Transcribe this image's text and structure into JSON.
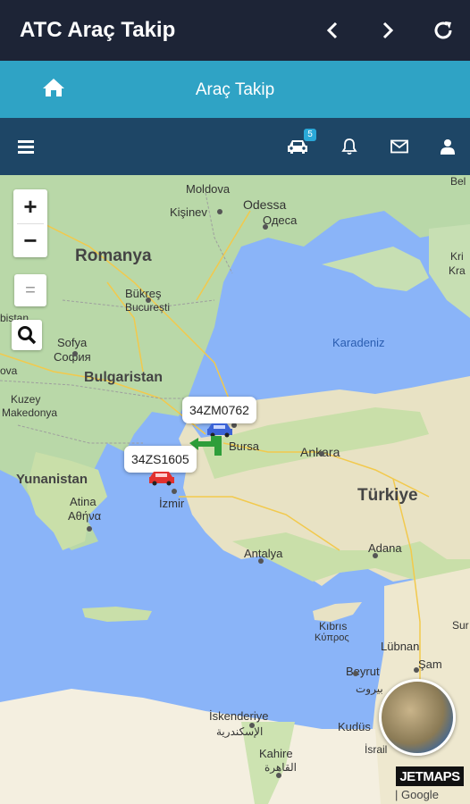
{
  "app": {
    "title": "ATC Araç Takip"
  },
  "subheader": {
    "title": "Araç Takip"
  },
  "navbar": {
    "vehicle_badge": "5"
  },
  "map": {
    "zoom_in": "+",
    "zoom_out": "−",
    "layers_btn": "=",
    "labels": {
      "moldova": "Moldova",
      "kisinev": "Kişinev",
      "odessa": "Odessa",
      "odesa": "Одеса",
      "romanya": "Romanya",
      "bukres": "Bükreş",
      "bukres_local": "București",
      "sofya": "Sofya",
      "sofiya": "София",
      "bulgaristan": "Bulgaristan",
      "kuzey_makedonya_1": "Kuzey",
      "kuzey_makedonya_2": "Makedonya",
      "bistan": "bistan",
      "ova": "ova",
      "yunanistan": "Yunanistan",
      "atina": "Atina",
      "athina": "Αθήνα",
      "karadeniz": "Karadeniz",
      "bursa": "Bursa",
      "ankara": "Ankara",
      "izmir": "İzmir",
      "turkiye": "Türkiye",
      "antalya": "Antalya",
      "adana": "Adana",
      "kibris": "Kıbrıs",
      "kibris_greek": "Κύπρος",
      "lubnan": "Lübnan",
      "beyrut": "Beyrut",
      "beyrut_arabic": "بيروت",
      "sam": "Şam",
      "iskenderiye": "İskenderiye",
      "iskenderiye_arabic": "الإسكندرية",
      "kudus": "Kudüs",
      "kahire": "Kahire",
      "kahire_arabic": "القاهرة",
      "israil": "İsrail",
      "krasnodar": "Kra",
      "crimea": "Kri",
      "bel": "Bel",
      "sur": "Sur"
    },
    "vehicles": [
      {
        "plate": "34ZM0762",
        "color": "#3b63d6"
      },
      {
        "plate": "34ZS1605",
        "color": "#e2312f"
      }
    ],
    "attribution": {
      "jetmaps": "JETMAPS",
      "google": "Google"
    }
  }
}
